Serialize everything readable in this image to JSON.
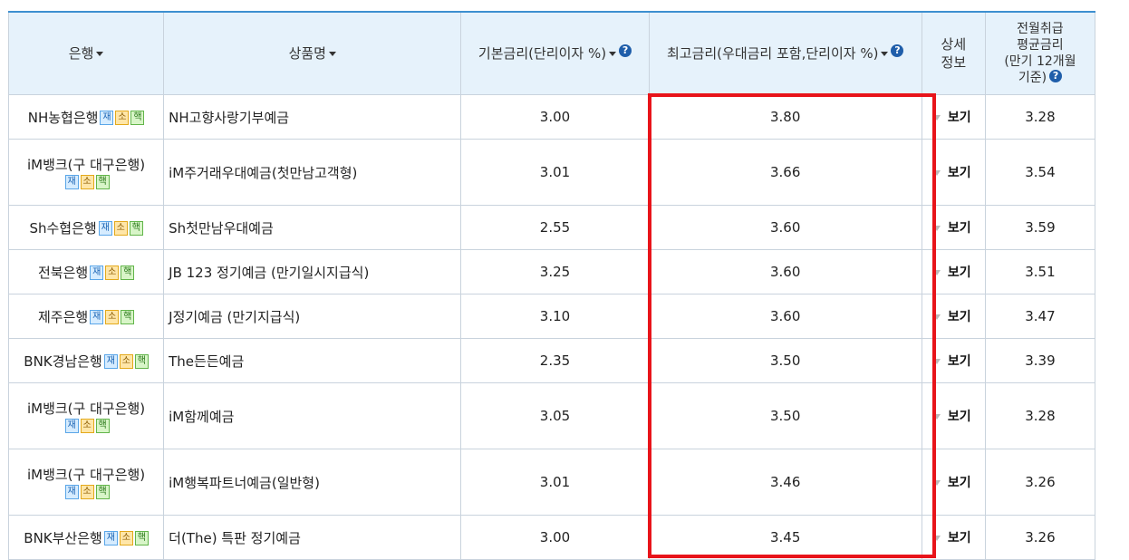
{
  "header": {
    "bank": "은행",
    "product": "상품명",
    "base_rate": "기본금리(단리이자 %)",
    "max_rate": "최고금리(우대금리 포함,단리이자 %)",
    "detail_line1": "상세",
    "detail_line2": "정보",
    "avg_line1": "전월취급",
    "avg_line2": "평균금리",
    "avg_line3": "(만기 12개월",
    "avg_line4": "기준)"
  },
  "badges": {
    "jae": "재",
    "so": "소",
    "haek": "핵"
  },
  "help_glyph": "?",
  "view_label": "보기",
  "rows": [
    {
      "bank": "NH농협은행",
      "product": "NH고향사랑기부예금",
      "base": "3.00",
      "max": "3.80",
      "avg": "3.28"
    },
    {
      "bank": "iM뱅크(구 대구은행)",
      "product": "iM주거래우대예금(첫만남고객형)",
      "base": "3.01",
      "max": "3.66",
      "avg": "3.54"
    },
    {
      "bank": "Sh수협은행",
      "product": "Sh첫만남우대예금",
      "base": "2.55",
      "max": "3.60",
      "avg": "3.59"
    },
    {
      "bank": "전북은행",
      "product": "JB 123 정기예금 (만기일시지급식)",
      "base": "3.25",
      "max": "3.60",
      "avg": "3.51"
    },
    {
      "bank": "제주은행",
      "product": "J정기예금 (만기지급식)",
      "base": "3.10",
      "max": "3.60",
      "avg": "3.47"
    },
    {
      "bank": "BNK경남은행",
      "product": "The든든예금",
      "base": "2.35",
      "max": "3.50",
      "avg": "3.39"
    },
    {
      "bank": "iM뱅크(구 대구은행)",
      "product": "iM함께예금",
      "base": "3.05",
      "max": "3.50",
      "avg": "3.28"
    },
    {
      "bank": "iM뱅크(구 대구은행)",
      "product": "iM행복파트너예금(일반형)",
      "base": "3.01",
      "max": "3.46",
      "avg": "3.26"
    },
    {
      "bank": "BNK부산은행",
      "product": "더(The) 특판 정기예금",
      "base": "3.00",
      "max": "3.45",
      "avg": "3.26"
    }
  ],
  "colors": {
    "header_bg": "#e6f2fb",
    "header_top_border": "#3d8fd0",
    "highlight": "#e8141a",
    "help_icon": "#1f5eaa"
  }
}
